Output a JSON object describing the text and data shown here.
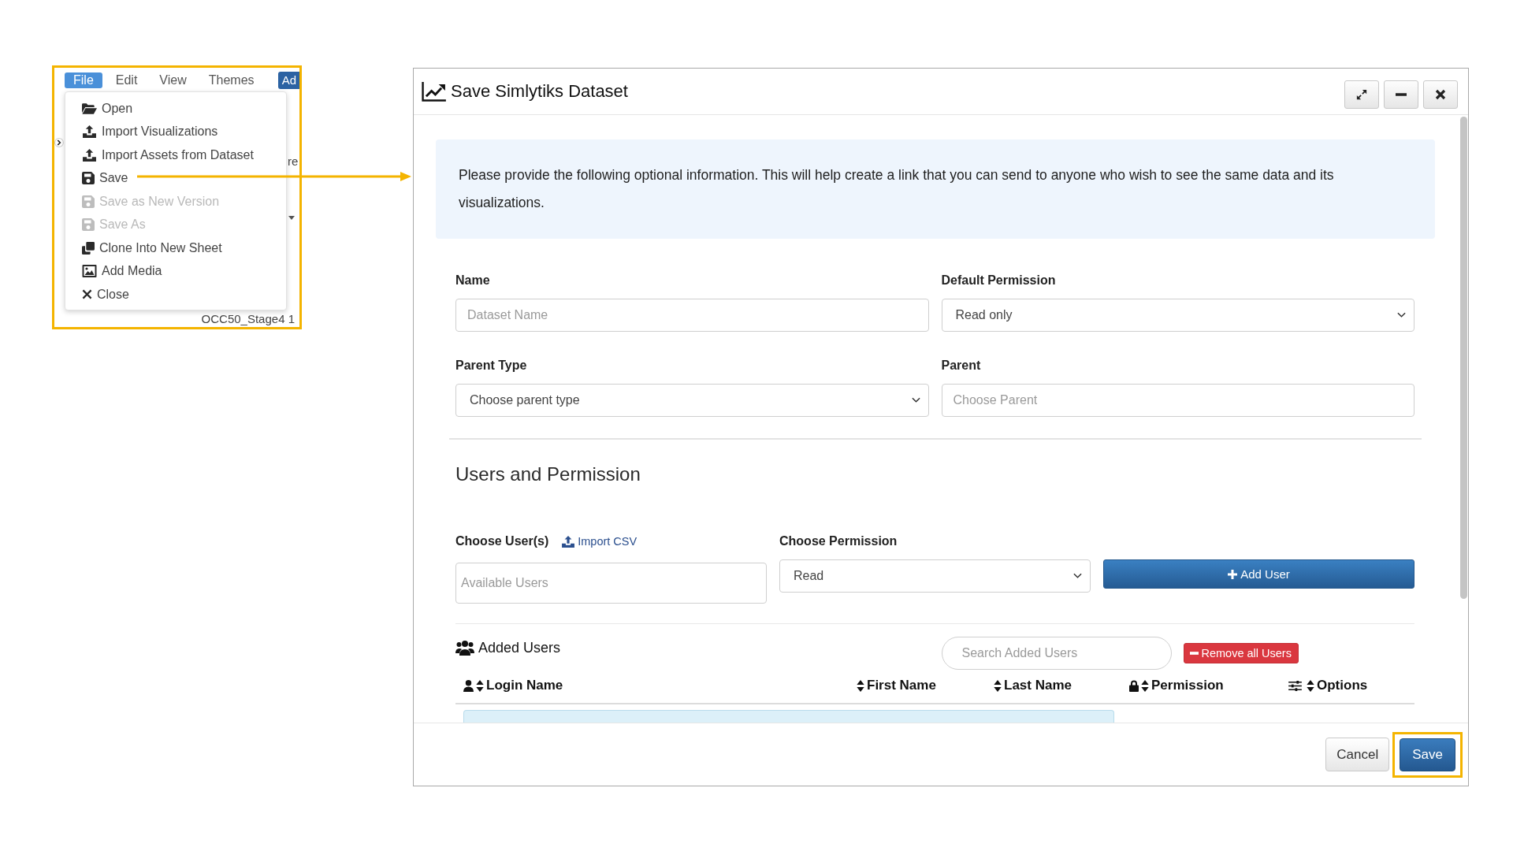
{
  "menu_screenshot": {
    "menubar": [
      {
        "label": "File",
        "selected": true
      },
      {
        "label": "Edit",
        "selected": false
      },
      {
        "label": "View",
        "selected": false
      },
      {
        "label": "Themes",
        "selected": false
      }
    ],
    "menubar_button": "Ad",
    "file_menu": [
      {
        "label": "Open",
        "disabled": false
      },
      {
        "label": "Import Visualizations",
        "disabled": false
      },
      {
        "label": "Import Assets from Dataset",
        "disabled": false
      },
      {
        "label": "Save",
        "disabled": false
      },
      {
        "label": "Save as New Version",
        "disabled": true
      },
      {
        "label": "Save As",
        "disabled": true
      },
      {
        "label": "Clone Into New Sheet",
        "disabled": false
      },
      {
        "label": "Add Media",
        "disabled": false
      },
      {
        "label": "Close",
        "disabled": false
      }
    ],
    "background_texts": [
      "re",
      "OCC50_Stage4 1"
    ]
  },
  "window": {
    "title": "Save Simlytiks Dataset"
  },
  "info": "Please provide the following optional information. This will help create a link that you can send to anyone who wish to see the same data and its visualizations.",
  "form": {
    "fields": [
      {
        "label": "Name",
        "kind": "input",
        "placeholder": "Dataset Name"
      },
      {
        "label": "Default Permission",
        "kind": "select",
        "value": "Read only"
      },
      {
        "label": "Parent Type",
        "kind": "select",
        "value": "Choose parent type"
      },
      {
        "label": "Parent",
        "kind": "input",
        "placeholder": "Choose Parent"
      }
    ]
  },
  "users_section": {
    "title": "Users and Permission",
    "users_label": "Choose User(s)",
    "import_link": "Import CSV",
    "users_field": {
      "placeholder": "Available Users"
    },
    "permission_label": "Choose Permission",
    "permission_select": {
      "value": "Read"
    },
    "add_button": "Add User"
  },
  "added_users": {
    "title": "Added Users",
    "search": {
      "placeholder": "Search Added Users"
    },
    "remove_button": "Remove all Users",
    "columns": [
      "Login Name",
      "First Name",
      "Last Name",
      "Permission",
      "Options"
    ]
  },
  "footer": {
    "buttons": [
      {
        "label": "Cancel",
        "kind": "secondary",
        "highlighted": false
      },
      {
        "label": "Save",
        "kind": "primary",
        "highlighted": true
      }
    ]
  }
}
